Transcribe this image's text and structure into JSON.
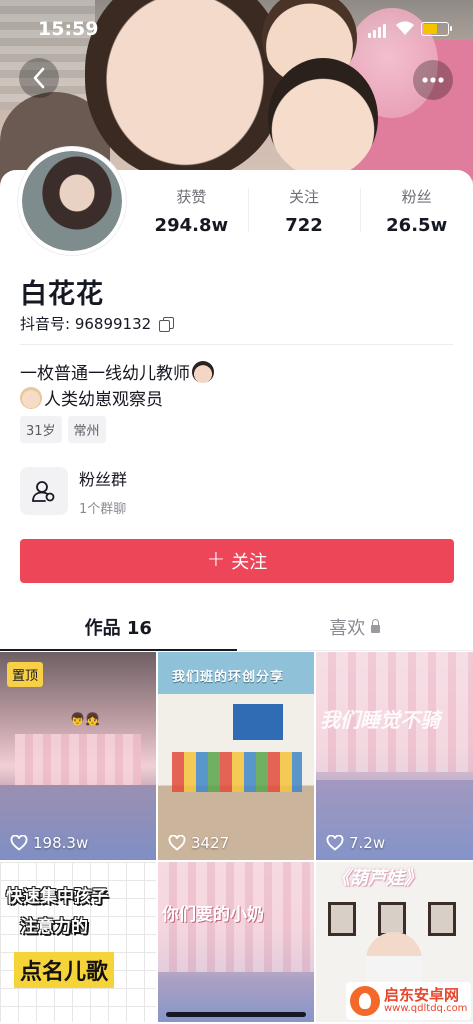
{
  "status_bar": {
    "time": "15:59"
  },
  "profile": {
    "name": "白花花",
    "douyin_id_label": "抖音号: 96899132",
    "stats": [
      {
        "label": "获赞",
        "value": "294.8w"
      },
      {
        "label": "关注",
        "value": "722"
      },
      {
        "label": "粉丝",
        "value": "26.5w"
      }
    ],
    "bio_line1": "一枚普通一线幼儿教师",
    "bio_line2": "人类幼崽观察员",
    "tags": [
      "31岁",
      "常州"
    ],
    "fans_group": {
      "title": "粉丝群",
      "subtitle": "1个群聊"
    },
    "follow_button": "关注"
  },
  "tabs": {
    "works": "作品 16",
    "likes": "喜欢"
  },
  "videos": [
    {
      "likes": "198.3w",
      "pinned_label": "置顶"
    },
    {
      "likes": "3427",
      "title": "我们班的环创分享"
    },
    {
      "likes": "7.2w",
      "title": "我们睡觉不骑"
    },
    {
      "line1": "快速集中孩子",
      "line2": "注意力的",
      "line3": "点名儿歌"
    },
    {
      "title": "你们要的小奶"
    },
    {
      "title": "《葫芦娃》"
    }
  ],
  "watermark": {
    "name": "启东安卓网",
    "url": "www.qdltdq.com"
  },
  "colors": {
    "accent": "#ee4659",
    "pinned": "#f7d047"
  }
}
